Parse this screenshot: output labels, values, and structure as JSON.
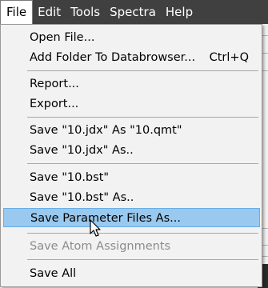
{
  "menubar": {
    "items": [
      {
        "label": "File"
      },
      {
        "label": "Edit"
      },
      {
        "label": "Tools"
      },
      {
        "label": "Spectra"
      },
      {
        "label": "Help"
      }
    ]
  },
  "file_menu": {
    "items": [
      {
        "label": "Open File..."
      },
      {
        "label": "Add Folder To Databrowser...",
        "shortcut": "Ctrl+Q"
      },
      {
        "label": "Report..."
      },
      {
        "label": "Export..."
      },
      {
        "label": "Save \"10.jdx\" As \"10.qmt\""
      },
      {
        "label": "Save \"10.jdx\" As.."
      },
      {
        "label": "Save \"10.bst\""
      },
      {
        "label": "Save \"10.bst\" As.."
      },
      {
        "label": "Save Parameter Files As...",
        "state": "highlighted"
      },
      {
        "label": "Save Atom Assignments",
        "state": "disabled"
      },
      {
        "label": "Save All"
      }
    ]
  },
  "cursor": {
    "icon": "arrow-cursor-icon"
  }
}
